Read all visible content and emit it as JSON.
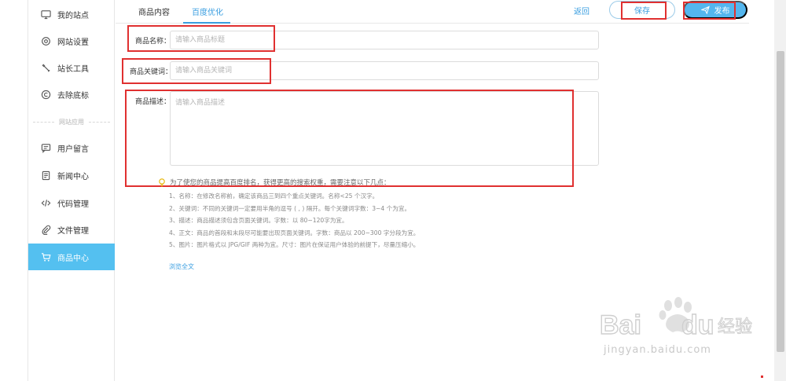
{
  "sidebar": {
    "items": [
      {
        "label": "我的站点",
        "icon": "monitor-icon"
      },
      {
        "label": "网站设置",
        "icon": "gear-icon"
      },
      {
        "label": "站长工具",
        "icon": "wrench-icon"
      },
      {
        "label": "去除底标",
        "icon": "copyright-icon"
      },
      {
        "label": "用户留言",
        "icon": "message-icon"
      },
      {
        "label": "新闻中心",
        "icon": "document-icon"
      },
      {
        "label": "代码管理",
        "icon": "code-icon"
      },
      {
        "label": "文件管理",
        "icon": "paperclip-icon"
      },
      {
        "label": "商品中心",
        "icon": "cart-icon"
      }
    ],
    "divider_label": "网站应用",
    "active_index": 8
  },
  "tabs": [
    {
      "label": "商品内容"
    },
    {
      "label": "百度优化"
    }
  ],
  "toolbar": {
    "back_label": "返回",
    "save_label": "保存",
    "publish_label": "发布"
  },
  "form": {
    "name_label": "商品名称：",
    "name_placeholder": "请输入商品标题",
    "keywords_label": "商品关键词：",
    "keywords_placeholder": "请输入商品关键词",
    "desc_label": "商品描述：",
    "desc_placeholder": "请输入商品描述"
  },
  "tips": {
    "heading": "为了使您的商品提高百度排名，获得更高的搜索权重，需要注意以下几点：",
    "lines": [
      "1、名称：在修改名称前，确定该商品三到四个重点关键词。名称<25 个汉字。",
      "2、关键词：不同的关键词一定要用半角的逗号 ( , ) 隔开。每个关键词字数：3~4 个为宜。",
      "3、描述：商品描述须包含页面关键词。字数：以 80~120字为宜。",
      "4、正文：商品的首段和末段尽可能要出现页面关键词。字数：商品以 200~300 字分段为宜。",
      "5、图片：图片格式以 JPG/GIF 两种为宜。尺寸：图片在保证用户体验的前提下，尽量压缩小。"
    ],
    "more_label": "浏览全文"
  },
  "watermark": {
    "url": "jingyan.baidu.com"
  },
  "colors": {
    "accent": "#3a9ee0",
    "active_bg": "#54c0f0",
    "annotation_red": "#e03030"
  }
}
